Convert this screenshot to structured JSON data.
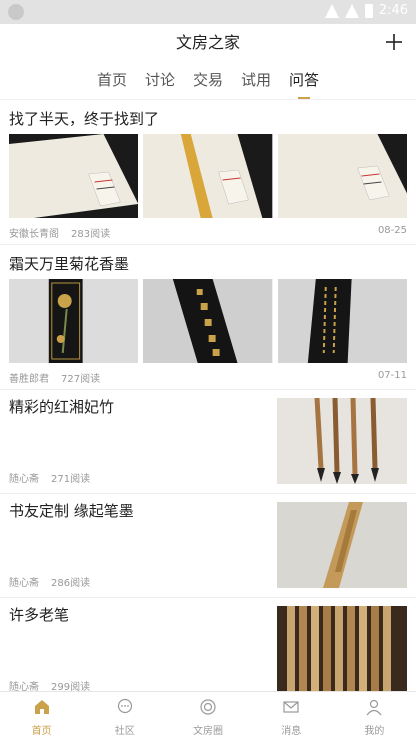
{
  "status": {
    "time": "2:46"
  },
  "app": {
    "title": "文房之家"
  },
  "tabs": [
    {
      "label": "首页"
    },
    {
      "label": "讨论"
    },
    {
      "label": "交易"
    },
    {
      "label": "试用"
    },
    {
      "label": "问答"
    }
  ],
  "active_tab": 4,
  "posts": [
    {
      "title": "找了半天，终于找到了",
      "author": "安徽长青阁",
      "reads": "283阅读",
      "date": "08-25"
    },
    {
      "title": "霜天万里菊花香墨",
      "author": "善胜郎君",
      "reads": "727阅读",
      "date": "07-11"
    },
    {
      "title": "精彩的红湘妃竹",
      "author": "随心斋",
      "reads": "271阅读"
    },
    {
      "title": "书友定制 缘起笔墨",
      "author": "随心斋",
      "reads": "286阅读"
    },
    {
      "title": "许多老笔",
      "author": "随心斋",
      "reads": "299阅读"
    }
  ],
  "nav": [
    {
      "label": "首页",
      "icon": "home-icon"
    },
    {
      "label": "社区",
      "icon": "chat-icon"
    },
    {
      "label": "文房圈",
      "icon": "circle-icon"
    },
    {
      "label": "消息",
      "icon": "mail-icon"
    },
    {
      "label": "我的",
      "icon": "user-icon"
    }
  ],
  "colors": {
    "accent": "#c9a24a",
    "status_bar": "#e2e2e2"
  }
}
